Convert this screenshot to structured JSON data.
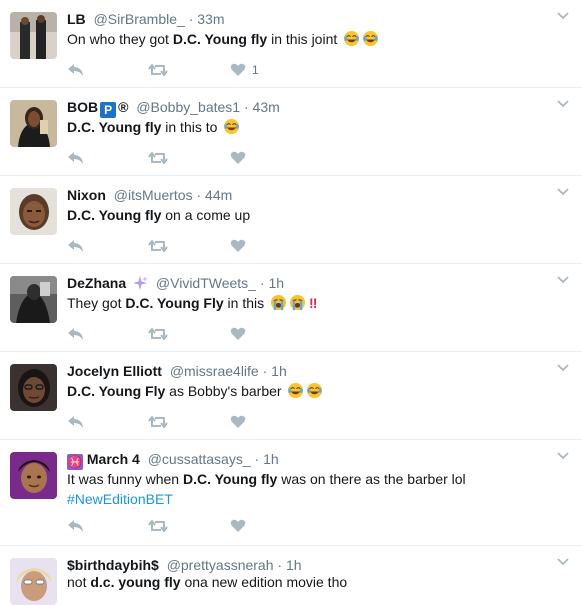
{
  "tweets": [
    {
      "fullname": "LB",
      "username": "@SirBramble_",
      "dot": "·",
      "time": "33m",
      "text_before": "On who they got ",
      "text_bold": "D.C. Young fly",
      "text_after": " in this joint",
      "emojis": [
        "face-with-tears-of-joy",
        "face-with-tears-of-joy"
      ],
      "like_count": "1"
    },
    {
      "fullname": "BOB",
      "badge": "P",
      "badge2": "®",
      "username": "@Bobby_bates1",
      "dot": "·",
      "time": "43m",
      "text_before": "",
      "text_bold": "D.C. Young fly",
      "text_after": " in this to",
      "emojis": [
        "face-with-tears-of-joy"
      ]
    },
    {
      "fullname": "Nixon",
      "username": "@itsMuertos",
      "dot": "·",
      "time": "44m",
      "text_before": "",
      "text_bold": "D.C. Young fly",
      "text_after": " on a come up"
    },
    {
      "fullname": "DeZhana",
      "username": "@VividTWeets_",
      "dot": "·",
      "time": "1h",
      "text_before": "They got ",
      "text_bold": "D.C. Young Fly",
      "text_after": " in this",
      "emojis": [
        "loudly-crying-face",
        "loudly-crying-face"
      ],
      "bang": "‼"
    },
    {
      "fullname": "Jocelyn Elliott",
      "username": "@missrae4life",
      "dot": "·",
      "time": "1h",
      "text_before": "",
      "text_bold": "D.C. Young Fly",
      "text_after": " as Bobby's barber",
      "emojis": [
        "face-with-tears-of-joy",
        "face-with-tears-of-joy"
      ]
    },
    {
      "fullname": "March 4",
      "username": "@cussattasays_",
      "dot": "·",
      "time": "1h",
      "text_before": "It was funny when ",
      "text_bold": "D.C. Young fly",
      "text_after": " was on there as the barber lol",
      "hashtag": "#NewEditionBET"
    },
    {
      "fullname": "$birthdaybih$",
      "username": "@prettyassnerah",
      "dot": "·",
      "time": "1h",
      "text_before": "not ",
      "text_bold": "d.c. young fly",
      "text_after": " ona new edition movie tho"
    }
  ],
  "colors": {
    "action_icon": "#aab8c2",
    "muted_text": "#657786",
    "link": "#1b95e0",
    "border": "#e6ecf0"
  }
}
